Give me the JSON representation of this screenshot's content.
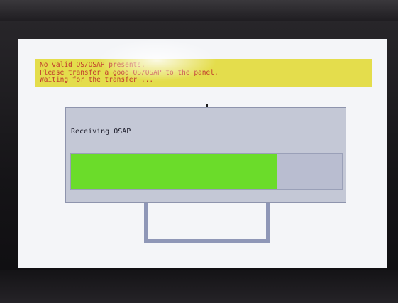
{
  "banner": {
    "lines": [
      "No valid OS/OSAP presents.",
      "Please transfer a good OS/OSAP to the panel.",
      "Waiting for the transfer ..."
    ]
  },
  "dialog": {
    "title": "Receiving OSAP",
    "progress": 0.76
  },
  "colors": {
    "banner_bg": "#e4dd4c",
    "banner_text": "#c0392b",
    "progress_fill": "#6bdc2a",
    "dialog_bg": "#c4c8d6",
    "screen_bg": "#f4f5f8"
  }
}
